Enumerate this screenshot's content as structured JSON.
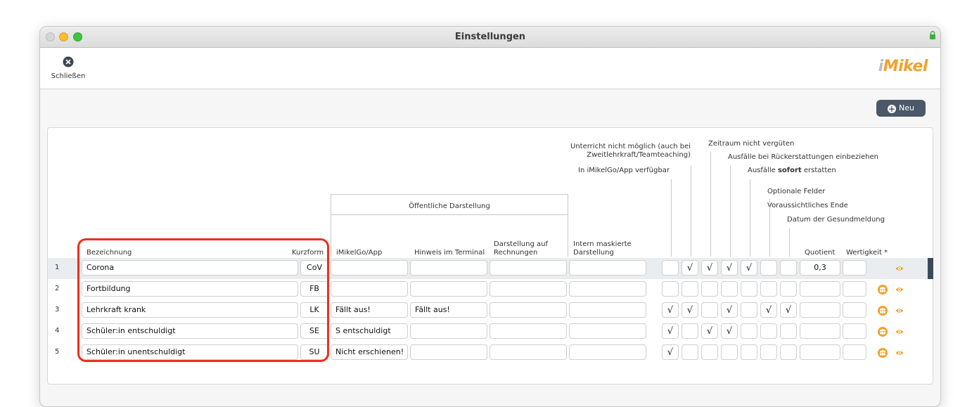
{
  "window": {
    "title": "Einstellungen"
  },
  "toolbar": {
    "close_label": "Schließen",
    "logo_text": "iMikel"
  },
  "actions": {
    "new_label": "Neu"
  },
  "annotations": {
    "unterricht_line1": "Unterricht nicht möglich (auch bei",
    "unterricht_line2": "Zweitlehrkraft/Teamteaching)",
    "imikelgo_app": "In iMikelGo/App verfügbar",
    "zeitraum": "Zeitraum nicht vergüten",
    "ausfaelle_rueck": "Ausfälle bei Rückerstattungen einbeziehen",
    "ausfaelle_sofort_pre": "Ausfälle ",
    "ausfaelle_sofort_bold": "sofort",
    "ausfaelle_sofort_post": " erstatten",
    "optionale": "Optionale Felder",
    "voraussichtlich": "Voraussichtliches Ende",
    "datum": "Datum der Gesundmeldung"
  },
  "group": {
    "title": "Öffentliche Darstellung"
  },
  "columns": {
    "bezeichnung": "Bezeichnung",
    "kurzform": "Kurzform",
    "imikelgo": "iMikelGo/App",
    "hinweis": "Hinweis im Terminal",
    "rechnung_line1": "Darstellung auf",
    "rechnung_line2": "Rechnungen",
    "intern_line1": "Intern maskierte",
    "intern_line2": "Darstellung",
    "quotient": "Quotient",
    "wertigkeit": "Wertigkeit *"
  },
  "rows": [
    {
      "num": "1",
      "name": "Corona",
      "short": "CoV",
      "app": "",
      "hint": "",
      "invoice": "",
      "intern": "",
      "checks": [
        "",
        "√",
        "√",
        "√",
        "√",
        "",
        ""
      ],
      "quotient": "0,3",
      "wertigkeit": "",
      "selected": true
    },
    {
      "num": "2",
      "name": "Fortbildung",
      "short": "FB",
      "app": "",
      "hint": "",
      "invoice": "",
      "intern": "",
      "checks": [
        "",
        "",
        "",
        "",
        "",
        "",
        ""
      ],
      "quotient": "",
      "wertigkeit": "",
      "selected": false
    },
    {
      "num": "3",
      "name": "Lehrkraft krank",
      "short": "LK",
      "app": "Fällt aus!",
      "hint": "Fällt aus!",
      "invoice": "",
      "intern": "",
      "checks": [
        "√",
        "√",
        "",
        "√",
        "",
        "√",
        "√"
      ],
      "quotient": "",
      "wertigkeit": "",
      "selected": false
    },
    {
      "num": "4",
      "name": "Schüler:in entschuldigt",
      "short": "SE",
      "app": "S entschuldigt",
      "hint": "",
      "invoice": "",
      "intern": "",
      "checks": [
        "√",
        "",
        "√",
        "√",
        "",
        "",
        ""
      ],
      "quotient": "",
      "wertigkeit": "",
      "selected": false
    },
    {
      "num": "5",
      "name": "Schüler:in unentschuldigt",
      "short": "SU",
      "app": "Nicht erschienen!",
      "hint": "",
      "invoice": "",
      "intern": "",
      "checks": [
        "√",
        "",
        "",
        "",
        "",
        "",
        ""
      ],
      "quotient": "",
      "wertigkeit": "",
      "selected": false
    }
  ],
  "colors": {
    "accent_orange": "#f2a12a",
    "selection_bar": "#3c4a58",
    "highlight_red": "#e8321e",
    "button_bg": "#4a5868"
  }
}
